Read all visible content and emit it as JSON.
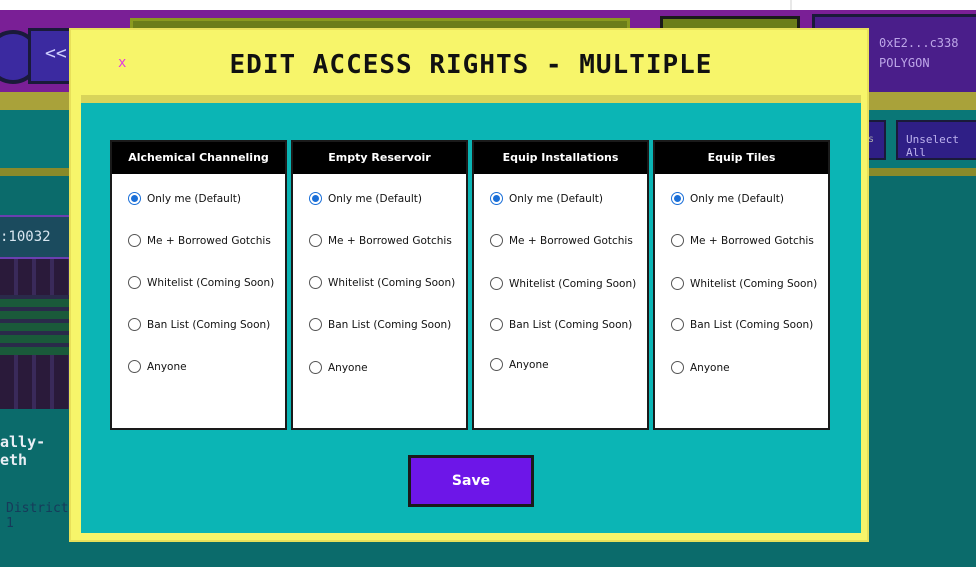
{
  "background": {
    "back_label": "<<",
    "wallet_address": "0xE2...c338",
    "wallet_network": "POLYGON",
    "unselect_all_label": "Unselect All",
    "partial_button_label": "s",
    "parcel_id": ":10032",
    "parcel_name": "ally-eth",
    "district_label": "District: 1"
  },
  "modal": {
    "close_label": "x",
    "title": "EDIT ACCESS RIGHTS - MULTIPLE",
    "save_label": "Save",
    "columns": [
      {
        "title": "Alchemical Channeling",
        "options": [
          "Only me (Default)",
          "Me + Borrowed Gotchis",
          "Whitelist (Coming Soon)",
          "Ban List (Coming Soon)",
          "Anyone"
        ],
        "selected": 0
      },
      {
        "title": "Empty Reservoir",
        "options": [
          "Only me (Default)",
          "Me + Borrowed Gotchis",
          "Whitelist (Coming Soon)",
          "Ban List (Coming Soon)",
          "Anyone"
        ],
        "selected": 0
      },
      {
        "title": "Equip Installations",
        "options": [
          "Only me (Default)",
          "Me + Borrowed Gotchis",
          "Whitelist (Coming Soon)",
          "Ban List (Coming Soon)",
          "Anyone"
        ],
        "selected": 0
      },
      {
        "title": "Equip Tiles",
        "options": [
          "Only me (Default)",
          "Me + Borrowed Gotchis",
          "Whitelist (Coming Soon)",
          "Ban List (Coming Soon)",
          "Anyone"
        ],
        "selected": 0
      }
    ]
  }
}
